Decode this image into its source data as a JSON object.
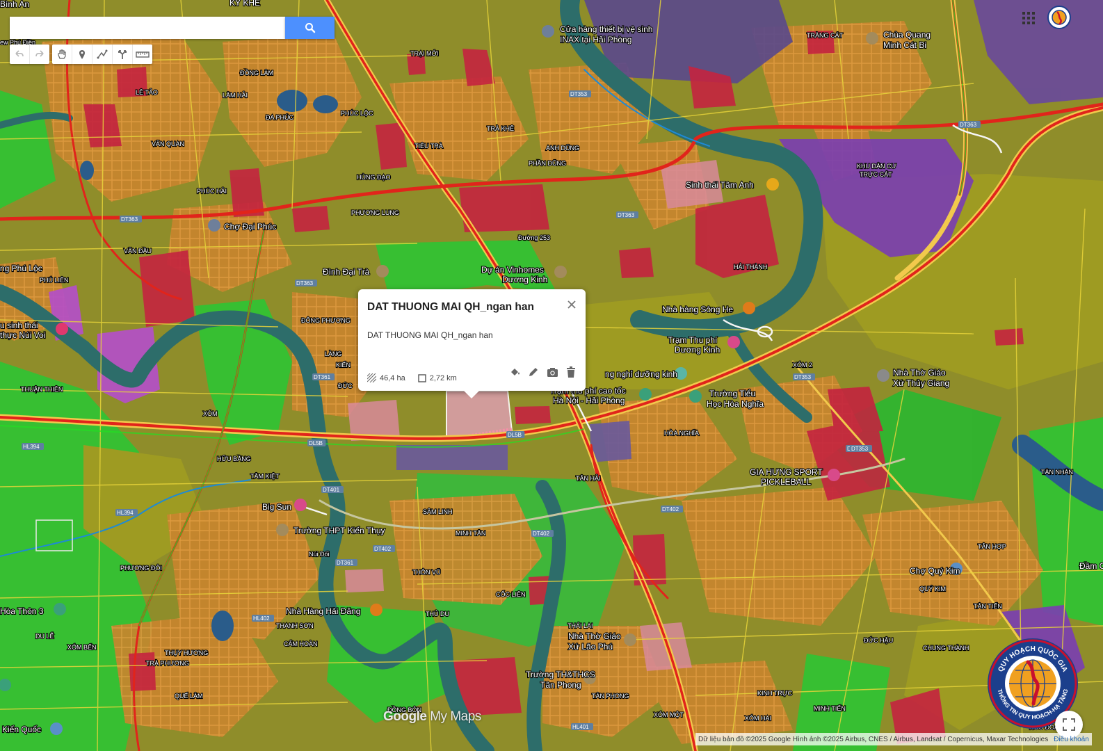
{
  "search": {
    "placeholder": "",
    "value": ""
  },
  "toolbar": {
    "group1": [
      "undo-icon",
      "redo-icon"
    ],
    "group2": [
      "hand-icon",
      "marker-icon",
      "draw-line-icon",
      "route-icon",
      "ruler-icon"
    ]
  },
  "popup": {
    "title": "DAT THUONG MAI QH_ngan han",
    "description": "DAT THUONG MAI QH_ngan han",
    "area": "46,4 ha",
    "perimeter": "2,72 km",
    "actions": [
      "paint-bucket-icon",
      "edit-pencil-icon",
      "camera-icon",
      "delete-trash-icon"
    ]
  },
  "places": {
    "binh_an": "Bình An",
    "ky_khe": "KỲ KHÊ",
    "ew_phu_dien": "ew Phú Điền",
    "inax_1": "Cửa hàng thiết bị vệ sinh",
    "inax_2": "INAX tại Hải Phòng",
    "trang_cat": "TRÀNG CÁT",
    "chua_quang_1": "Chùa Quang",
    "chua_quang_2": "Minh Cát Bi",
    "trai_moi": "TRẠI MỚI",
    "dong_lam": "ĐỒNG LÂM",
    "le_tao": "LÊ TẢO",
    "lam_hai": "LÂM HẢI",
    "phuc_loc": "PHÚC LỘC",
    "da_phuc": "ĐA PHÚC",
    "tra_khe": "TRÀ KHÊ",
    "anh_dung": "ANH DŨNG",
    "van_quan": "VĂN QUAN",
    "tieu_tra": "TIÊU TRÀ",
    "phan_dung": "PHẦN DŨNG",
    "khu_dan_cu_1": "KHU DÂN CƯ",
    "khu_dan_cu_2": "TRỰC CÁT",
    "phuc_hai": "PHÚC HẢI",
    "hung_dao": "HÙNG ĐẠO",
    "sinh_thai_tam_anh": "Sinh thái Tâm Anh",
    "phuong_lung": "PHƯƠNG LUNG",
    "cho_dai_phuc": "Chợ Đại Phúc",
    "van_dau": "VĂN ĐẦU",
    "duong_253": "Đường 253",
    "hai_thanh": "HẢI THÀNH",
    "dinh_dai_tra": "Đình Đại Trà",
    "vinhomes_1": "Dự án Vinhomes",
    "vinhomes_2": "Dương Kinh",
    "phu_lien": "PHÚ LIÊN",
    "ng_phu_loc": "ng Phú Lộc",
    "nha_hang_song_he": "Nhà hàng Sông He",
    "sinh_thai_nui_voi_1": "u sinh thái",
    "sinh_thai_nui_voi_2": "thực Núi Voi",
    "dong_phuong": "ĐÔNG PHƯƠNG",
    "tram_thu_phi_1": "Trạm Thu phí",
    "tram_thu_phi_2": "Dương Kinh",
    "lang_kien": "LÀNG",
    "kien": "KIẾN",
    "xom_2": "XÓM 2",
    "nha_tho_giao_1": "Nhà Thờ Giáo",
    "nha_tho_giao_2": "Xứ Thủy Giang",
    "thuan_thien": "THUẬN THIÊN",
    "duc": "ĐỨC",
    "duong_kinh_kg": "ng nghỉ dưỡng kinh",
    "cao_toc_1": "Trạm thu phí cao tốc",
    "cao_toc_2": "Hà Nội - Hải Phòng",
    "truong_tieu_1": "Trường Tiểu",
    "truong_tieu_2": "Học Hòa Nghĩa",
    "xom": "XÓM",
    "hoa_nghia": "HÒA NGHĨA",
    "huu_bang": "HỮU BẰNG",
    "tam_kiet": "TÂM KIỆT",
    "tan_hai": "TÂN HẢI",
    "gia_hung_1": "GIA HƯNG SPORT",
    "gia_hung_2": "PICKLEBALL",
    "tan_nhan": "TÂN NHÂN",
    "big_sun": "Big Sun",
    "sam_linh": "SÂM LINH",
    "truong_thpt": "Trường THPT Kiến Thụy",
    "minh_tan": "MINH TÂN",
    "nui_doi": "Núi Đối",
    "phuong_doi": "PHƯƠNG ĐÔI",
    "thon_vu": "THÔN VŨ",
    "tan_hop": "TÂN HỢP",
    "cho_quy_kim": "Chợ Quý Kim",
    "quy_kim": "QUÝ KIM",
    "dam_c": "Đầm C",
    "coc_lien": "CỐC LIÊN",
    "hoa_thon_3": "Hòa Thôn 3",
    "nha_hang_hai_dang": "Nhà Hàng Hải Đăng",
    "thu_du": "THỦ DU",
    "tan_tien": "TÂN TIẾN",
    "du_le": "DU LỄ",
    "thanh_son": "THANH SƠN",
    "thai_lai": "THÁI LAI",
    "nha_tho_lao_phu_1": "Nhà Thờ Giáo",
    "nha_tho_lao_phu_2": "Xứ Lão Phú",
    "duc_hau": "ĐỨC HẬU",
    "chung_thanh": "CHUNG THÀNH",
    "xom_ben": "XÓM BẾN",
    "cam_hoan": "CẨM HOÀN",
    "thuy_huong": "THỤY HƯƠNG",
    "tra_phuong": "TRÀ PHƯƠNG",
    "truong_thcs_1": "Trường TH&THCS",
    "truong_thcs_2": "Tân Phong",
    "que_lam": "QUẾ LÂM",
    "tan_phong": "TÂN PHONG",
    "kinh_truc": "KINH TRỰC",
    "minh_tien": "MINH TIẾN",
    "dong_bon": "ĐỒNG BÔN",
    "xom_mot": "XÓM MỘT",
    "xom_hai": "XÓM HAI",
    "kien_quoc": "Kiến Quốc",
    "ngu_doan": "NGŨ ĐOAN"
  },
  "road_labels": [
    "DT353",
    "DT353",
    "DT353",
    "DT363",
    "DT363",
    "DT363",
    "DT363",
    "DT361",
    "DT361",
    "DT402",
    "DT402",
    "DT402",
    "DT401",
    "HL394",
    "HL394",
    "HL401",
    "HL402",
    "DL5B",
    "DL5B",
    "DT353"
  ],
  "brand": {
    "google": "Google",
    "mymaps": " My Maps"
  },
  "attribution": {
    "text": "Dữ liệu bản đồ ©2025 Google Hình ảnh ©2025 Airbus, CNES / Airbus, Landsat / Copernicus, Maxar Technologies",
    "terms": "Điều khoản"
  },
  "logo": {
    "top_text": "QUY HOẠCH QUỐC GIA",
    "bottom_text": "THÔNG TIN QUY HOẠCH-HẠ TẦNG"
  },
  "colors": {
    "residential": "#c8852e",
    "agriculture": "#2fc22f",
    "commercial": "#c4233f",
    "industrial": "#7b3fb0",
    "water": "#2d6d6a",
    "road": "#e1241b",
    "popup_accent": "#4d90fe"
  }
}
